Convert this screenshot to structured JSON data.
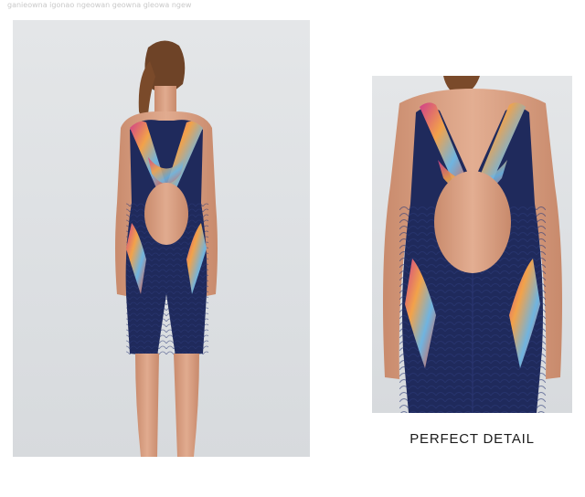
{
  "watermark": {
    "text": "ganieowna igonao ngeowan geowna gleowa ngew"
  },
  "photos": [
    {
      "name": "back-view-full",
      "subject": "model wearing knee-length swimsuit, back view"
    },
    {
      "name": "back-view-detail",
      "subject": "close-up of open back and printed straps"
    }
  ],
  "caption": {
    "text": "PERFECT DETAIL"
  },
  "colors": {
    "background": "#ffffff",
    "studio": "#dcdfe2",
    "suit_navy": "#1f2a5c",
    "skin": "#d8a184",
    "hair": "#7a4a2a",
    "print_orange": "#f2a24a",
    "print_magenta": "#d03f8a",
    "print_blue": "#6fb4e0"
  }
}
